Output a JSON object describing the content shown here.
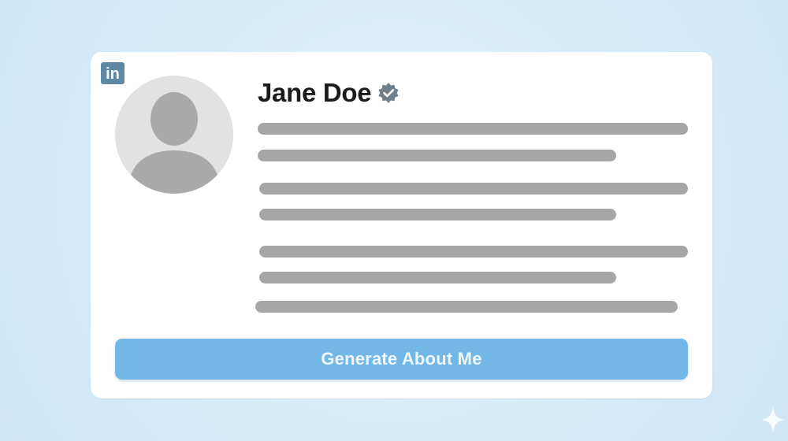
{
  "card": {
    "brand_logo_text": "in",
    "profile_name": "Jane Doe",
    "verified_badge": "verified-check-icon",
    "avatar": "default-person-icon",
    "generate_button_label": "Generate About Me"
  },
  "icons": {
    "brand": "linkedin-logo-icon",
    "verified": "verified-badge-icon",
    "sparkle": "sparkle-icon"
  },
  "colors": {
    "background": "#d8ecf9",
    "card": "#ffffff",
    "button": "#72b7e6",
    "button_text": "#eef7fd",
    "placeholder_lines": "#a6a6a6",
    "brand": "#5f87a6"
  }
}
